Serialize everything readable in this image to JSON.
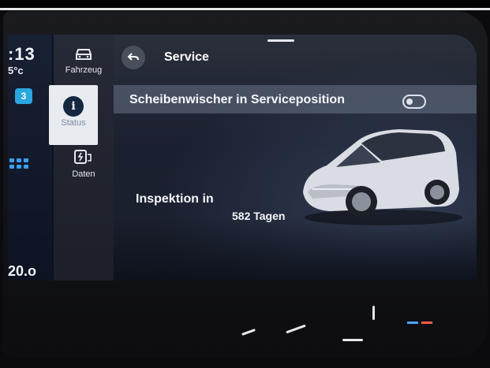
{
  "left_strip": {
    "clock": ":13",
    "temperature": "5°c",
    "badge": "3",
    "odometer": "20.o"
  },
  "nav": {
    "items": [
      {
        "label": "Fahrzeug",
        "icon": "car-icon"
      },
      {
        "label": "Status",
        "icon": "info-icon"
      },
      {
        "label": "Daten",
        "icon": "charging-data-icon"
      }
    ]
  },
  "service": {
    "title": "Service",
    "wiper_label": "Scheibenwischer in Serviceposition",
    "inspection_label": "Inspektion in",
    "inspection_value": "582 Tagen"
  },
  "colors": {
    "accent": "#2aa6e0",
    "active_nav_bg": "#e8ebef"
  }
}
